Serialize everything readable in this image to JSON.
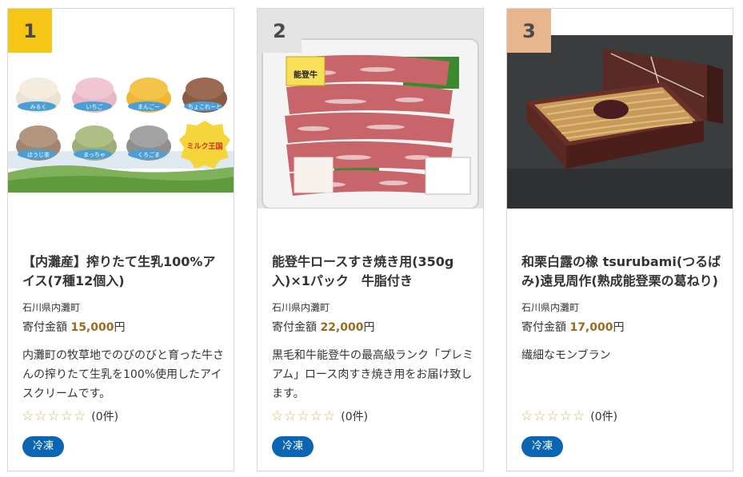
{
  "colors": {
    "rank1": "#f5c518",
    "rank2": "#e3e3e3",
    "rank3": "#e8b58c",
    "badge": "#0a66b3",
    "amount": "#9a6a1f",
    "star": "#d7b46a"
  },
  "cards": [
    {
      "rank": "1",
      "title": "【内灘産】搾りたて生乳100%アイス(7種12個入)",
      "town": "石川県内灘町",
      "amount_label": "寄付金額",
      "amount_value": "15,000",
      "amount_unit": "円",
      "description": "内灘町の牧草地でのびのびと育った牛さんの搾りたて生乳を100%使用したアイスクリームです。",
      "review_count": "(0件)",
      "badge": "冷凍",
      "image_labels": [
        "みるく",
        "いちご",
        "まんごー",
        "ちょこれーと",
        "ほうじ茶",
        "まっちゃ",
        "くろごま"
      ],
      "logo_text": "ミルク王国"
    },
    {
      "rank": "2",
      "title": "能登牛ロースすき焼き用(350g入)×1パック　牛脂付き",
      "town": "石川県内灘町",
      "amount_label": "寄付金額",
      "amount_value": "22,000",
      "amount_unit": "円",
      "description": "黒毛和牛能登牛の最高級ランク「プレミアム」ロース肉すき焼き用をお届け致します。",
      "review_count": "(0件)",
      "badge": "冷凍",
      "sticker_text": "能登牛"
    },
    {
      "rank": "3",
      "title": "和栗白露の橡 tsurubami(つるばみ)遠見周作(熟成能登栗の葛ねり)",
      "town": "石川県内灘町",
      "amount_label": "寄付金額",
      "amount_value": "17,000",
      "amount_unit": "円",
      "description": "繊細なモンブラン",
      "review_count": "(0件)",
      "badge": "冷凍"
    }
  ]
}
